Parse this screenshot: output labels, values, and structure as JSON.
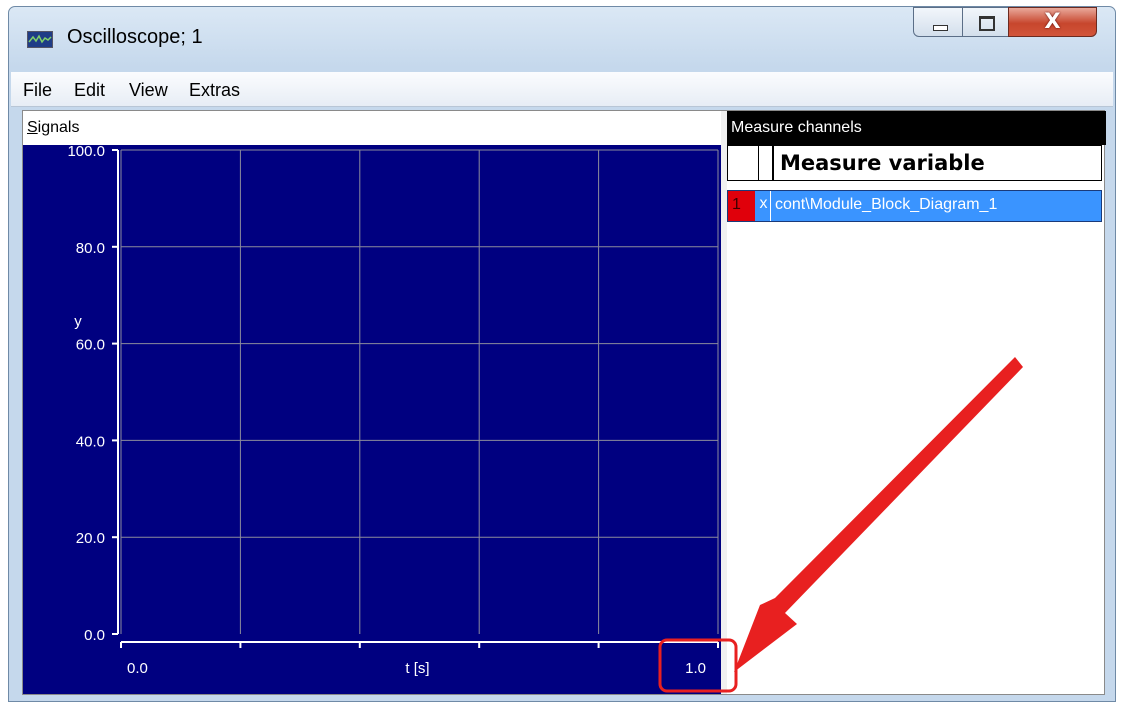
{
  "window": {
    "title": "Oscilloscope; 1",
    "app_icon": "oscilloscope-icon",
    "controls": {
      "close_glyph": "X"
    }
  },
  "menu": {
    "items": [
      "File",
      "Edit",
      "View",
      "Extras"
    ]
  },
  "signals": {
    "label": "Signals"
  },
  "measure": {
    "label": "Measure channels",
    "column_header": "Measure variable",
    "rows": [
      {
        "index": "1",
        "flag": "x",
        "variable": "cont\\Module_Block_Diagram_1",
        "color": "#e0000b"
      }
    ]
  },
  "chart_data": {
    "type": "line",
    "background": "#000080",
    "grid": true,
    "xlabel": "t [s]",
    "ylabel": "y",
    "xlim": [
      0.0,
      1.0
    ],
    "ylim": [
      0.0,
      100.0
    ],
    "x_ticks": [
      "0.0",
      "1.0"
    ],
    "y_ticks": [
      "0.0",
      "20.0",
      "40.0",
      "60.0",
      "80.0",
      "100.0"
    ],
    "series": []
  },
  "annotation": {
    "highlight": "1.0",
    "color": "#e82020"
  }
}
